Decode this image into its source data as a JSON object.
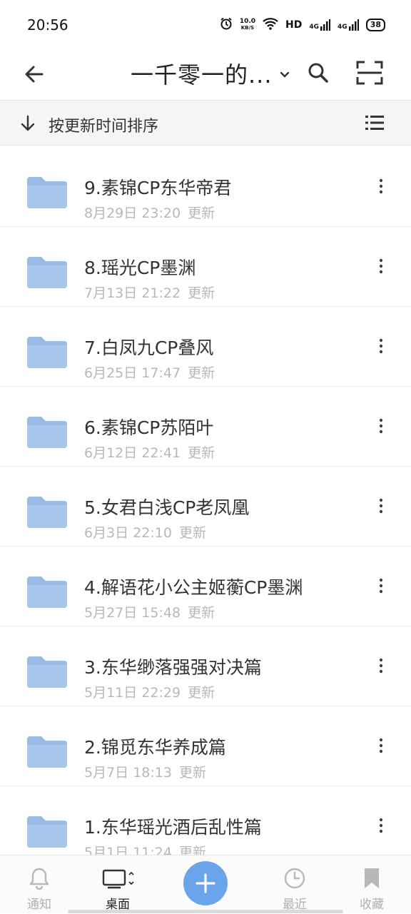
{
  "status_bar": {
    "time": "20:56",
    "speed_value": "10.0",
    "speed_unit": "KB/S",
    "hd": "HD",
    "net1": "4G",
    "net2": "4G",
    "battery": "38"
  },
  "top_bar": {
    "title": "一千零一的..."
  },
  "sort_bar": {
    "label": "按更新时间排序"
  },
  "folders": [
    {
      "name": "9.素锦CP东华帝君",
      "date": "8月29日 23:20",
      "status": "更新"
    },
    {
      "name": "8.瑶光CP墨渊",
      "date": "7月13日 21:22",
      "status": "更新"
    },
    {
      "name": "7.白凤九CP叠风",
      "date": "6月25日 17:47",
      "status": "更新"
    },
    {
      "name": "6.素锦CP苏陌叶",
      "date": "6月12日 22:41",
      "status": "更新"
    },
    {
      "name": "5.女君白浅CP老凤凰",
      "date": "6月3日 22:10",
      "status": "更新"
    },
    {
      "name": "4.解语花小公主姬蘅CP墨渊",
      "date": "5月27日 15:48",
      "status": "更新"
    },
    {
      "name": "3.东华缈落强强对决篇",
      "date": "5月11日 22:29",
      "status": "更新"
    },
    {
      "name": "2.锦觅东华养成篇",
      "date": "5月7日 18:13",
      "status": "更新"
    },
    {
      "name": "1.东华瑶光酒后乱性篇",
      "date": "5月1日 11:24",
      "status": "更新"
    }
  ],
  "bottom_nav": {
    "notify": "通知",
    "desktop": "桌面",
    "recent": "最近",
    "favorites": "收藏"
  },
  "colors": {
    "folder": "#9bbbe6",
    "accent": "#6aa5ec"
  }
}
